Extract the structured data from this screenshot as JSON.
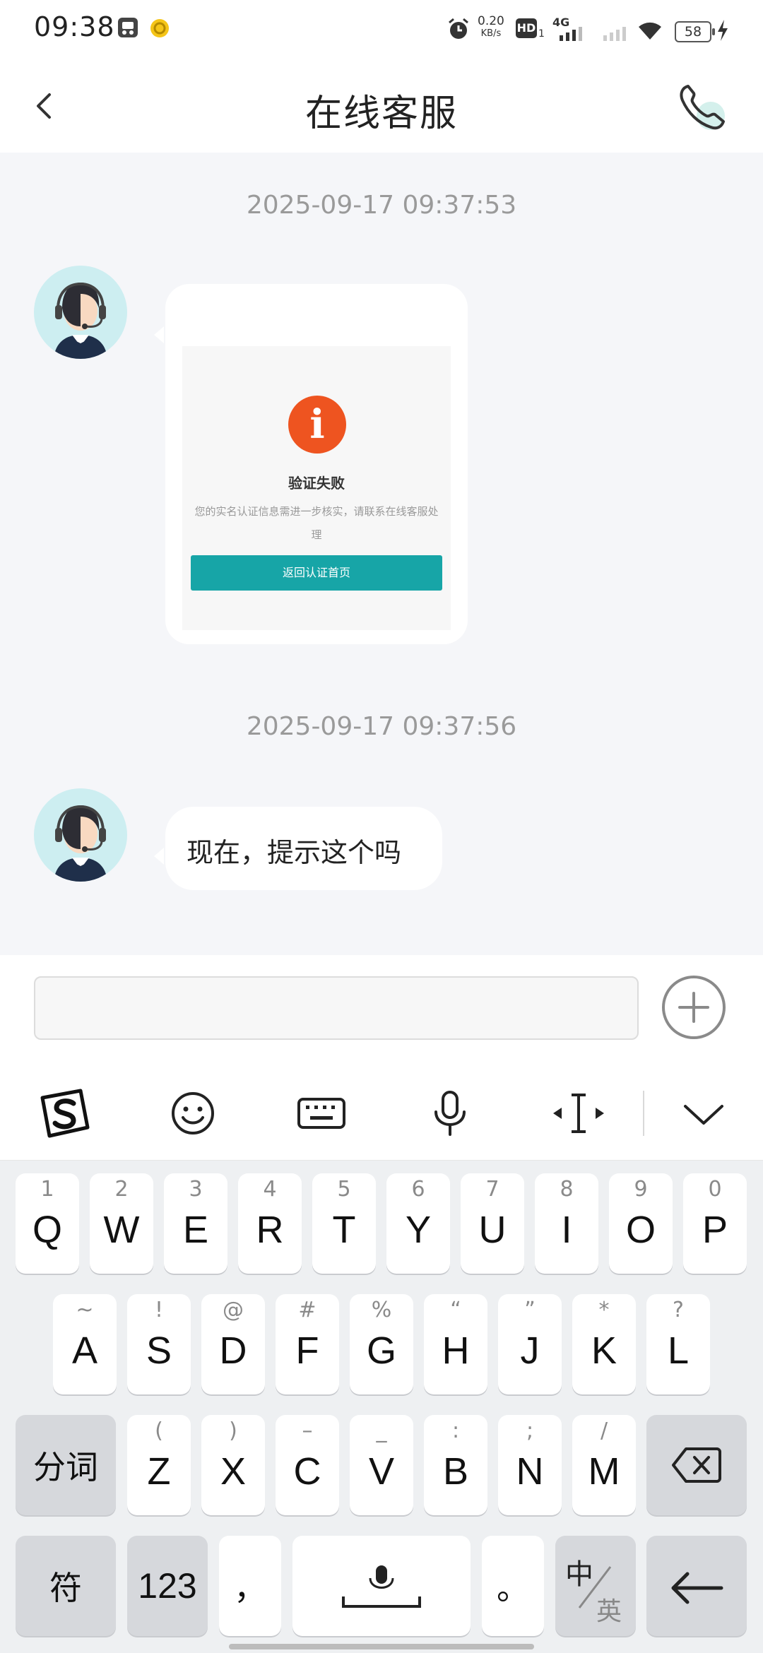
{
  "status_bar": {
    "time": "09:38",
    "net_speed_value": "0.20",
    "net_speed_unit": "KB/s",
    "hd_label": "HD",
    "hd_sub": "1",
    "network_type": "4G",
    "battery": "58",
    "icons": [
      "app-shield-icon",
      "coin-icon",
      "alarm-icon",
      "hd-icon",
      "signal-4g-icon",
      "signal-icon",
      "wifi-icon",
      "battery-icon",
      "charging-icon"
    ]
  },
  "header": {
    "title": "在线客服",
    "back_icon": "chevron-left-icon",
    "call_icon": "phone-icon"
  },
  "chat": {
    "messages": [
      {
        "timestamp": "2025-09-17 09:37:53",
        "type": "image",
        "image": {
          "icon": "info-icon",
          "icon_glyph": "i",
          "title": "验证失败",
          "description": "您的实名认证信息需进一步核实，请联系在线客服处理",
          "button_label": "返回认证首页",
          "accent_color": "#17a5a7",
          "alert_color": "#ee5420"
        }
      },
      {
        "timestamp": "2025-09-17 09:37:56",
        "type": "text",
        "text": "现在，提示这个吗"
      }
    ]
  },
  "input_bar": {
    "value": "",
    "placeholder": "",
    "plus_icon": "plus-circle-icon"
  },
  "keyboard_toolbar": {
    "icons": [
      "sogou-logo-icon",
      "emoji-icon",
      "keyboard-icon",
      "microphone-icon",
      "cursor-move-icon",
      "collapse-chevron-icon"
    ]
  },
  "keyboard": {
    "row1": [
      {
        "hint": "1",
        "key": "Q"
      },
      {
        "hint": "2",
        "key": "W"
      },
      {
        "hint": "3",
        "key": "E"
      },
      {
        "hint": "4",
        "key": "R"
      },
      {
        "hint": "5",
        "key": "T"
      },
      {
        "hint": "6",
        "key": "Y"
      },
      {
        "hint": "7",
        "key": "U"
      },
      {
        "hint": "8",
        "key": "I"
      },
      {
        "hint": "9",
        "key": "O"
      },
      {
        "hint": "0",
        "key": "P"
      }
    ],
    "row2": [
      {
        "hint": "~",
        "key": "A"
      },
      {
        "hint": "!",
        "key": "S"
      },
      {
        "hint": "@",
        "key": "D"
      },
      {
        "hint": "#",
        "key": "F"
      },
      {
        "hint": "%",
        "key": "G"
      },
      {
        "hint": "“",
        "key": "H"
      },
      {
        "hint": "”",
        "key": "J"
      },
      {
        "hint": "*",
        "key": "K"
      },
      {
        "hint": "?",
        "key": "L"
      }
    ],
    "row3": [
      {
        "hint": "(",
        "key": "Z"
      },
      {
        "hint": ")",
        "key": "X"
      },
      {
        "hint": "–",
        "key": "C"
      },
      {
        "hint": "_",
        "key": "V"
      },
      {
        "hint": ":",
        "key": "B"
      },
      {
        "hint": ";",
        "key": "N"
      },
      {
        "hint": "/",
        "key": "M"
      }
    ],
    "segment_label": "分词",
    "backspace_icon": "backspace-icon",
    "symbols_label": "符",
    "numbers_label": "123",
    "comma_label": "，",
    "space_icon": "space-mic-icon",
    "period_label": "。",
    "lang_top": "中",
    "lang_bottom": "英",
    "enter_icon": "enter-arrow-icon"
  }
}
